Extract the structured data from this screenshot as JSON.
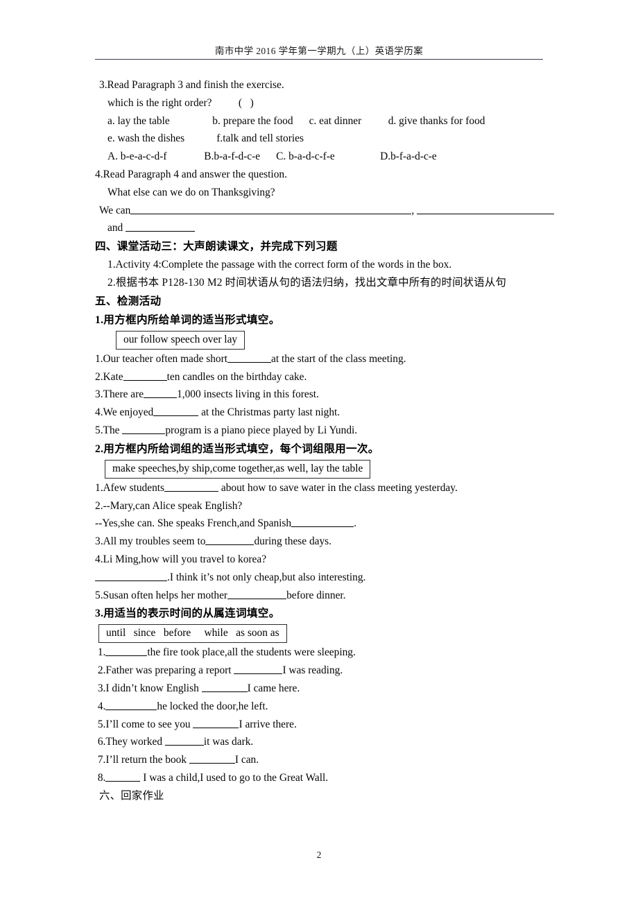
{
  "header": {
    "title": "南市中学 2016 学年第一学期九（上）英语学历案"
  },
  "footer": {
    "page_number": "2"
  },
  "body": {
    "q3": {
      "stem": "3.Read Paragraph 3 and finish the exercise.",
      "question": "which is the right order?          (   )",
      "options_row1": "a. lay the table                b. prepare the food      c. eat dinner          d. give thanks for food",
      "options_row2": "e. wash the dishes            f.talk and tell stories",
      "answers": "A. b-e-a-c-d-f              B.b-a-f-d-c-e      C. b-a-d-c-f-e                 D.b-f-a-d-c-e"
    },
    "q4": {
      "stem": "4.Read Paragraph 4 and answer the question.",
      "question": "What else can we do on Thanksgiving?",
      "answer_prefix": "We can",
      "answer_sep": ",",
      "answer_and": "and"
    },
    "section4": {
      "heading": "四、课堂活动三：大声朗读课文，并完成下列习题",
      "item1": "1.Activity 4:Complete the passage with the correct form of the words in the box.",
      "item2": "2.根据书本 P128-130 M2 时间状语从句的语法归纳，找出文章中所有的时间状语从句"
    },
    "section5": {
      "heading": "五、检测活动",
      "ex1": {
        "heading": "1.用方框内所给单词的适当形式填空。",
        "box": "our follow speech over lay",
        "items": [
          {
            "pre": "1.Our teacher often made short",
            "post": "at the start of the class meeting."
          },
          {
            "pre": "2.Kate",
            "post": "ten candles on the birthday cake."
          },
          {
            "pre": "3.There are",
            "post": "1,000 insects living in this forest."
          },
          {
            "pre": "4.We enjoyed",
            "post": " at the Christmas party last night."
          },
          {
            "pre": "5.The ",
            "post": "program is a piano piece played by Li Yundi."
          }
        ]
      },
      "ex2": {
        "heading": "2.用方框内所给词组的适当形式填空，每个词组限用一次。",
        "box": "make speeches,by ship,come together,as well, lay the table",
        "items": [
          {
            "pre": "1.Afew students",
            "post": " about how to save water in the class meeting yesterday."
          },
          {
            "pre": "2.--Mary,can Alice speak English?",
            "post": ""
          },
          {
            "pre": "--Yes,she can. She speaks French,and Spanish",
            "post": "."
          },
          {
            "pre": "3.All my troubles seem to",
            "post": "during these days."
          },
          {
            "pre": "4.Li Ming,how will you travel to korea?",
            "post": ""
          },
          {
            "pre": "",
            "post": ".I think it’s not only cheap,but also interesting."
          },
          {
            "pre": "5.Susan often helps her mother",
            "post": "before dinner."
          }
        ]
      },
      "ex3": {
        "heading": "3.用适当的表示时间的从属连词填空。",
        "box": "until   since   before     while   as soon as",
        "items": [
          {
            "pre": " 1.",
            "post": "the fire took place,all the students were sleeping."
          },
          {
            "pre": " 2.Father was preparing a report ",
            "post": "I was reading."
          },
          {
            "pre": " 3.I didn’t know English ",
            "post": "I came here."
          },
          {
            "pre": " 4.",
            "post": "he locked the door,he left."
          },
          {
            "pre": " 5.I’ll come to see you ",
            "post": "I arrive there."
          },
          {
            "pre": " 6.They worked ",
            "post": "it was dark."
          },
          {
            "pre": " 7.I’ll return the book ",
            "post": "I can."
          },
          {
            "pre": " 8.",
            "post": " I was a child,I used to go to the Great Wall."
          }
        ]
      }
    },
    "section6": {
      "heading": "六、回家作业"
    }
  }
}
